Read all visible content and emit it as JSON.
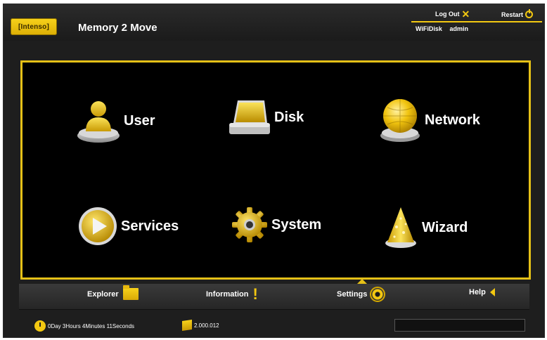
{
  "header": {
    "logo_text": "[Intenso]",
    "app_title": "Memory 2 Move",
    "logout_label": "Log Out",
    "restart_label": "Restart",
    "device_name": "WiFiDisk",
    "username": "admin"
  },
  "main": {
    "tiles": [
      {
        "label": "User",
        "icon": "user-icon"
      },
      {
        "label": "Disk",
        "icon": "disk-icon"
      },
      {
        "label": "Network",
        "icon": "network-globe-icon"
      },
      {
        "label": "Services",
        "icon": "play-icon"
      },
      {
        "label": "System",
        "icon": "gear-icon"
      },
      {
        "label": "Wizard",
        "icon": "wizard-hat-icon"
      }
    ]
  },
  "nav": {
    "explorer": "Explorer",
    "information": "Information",
    "settings": "Settings",
    "help": "Help",
    "active": "Settings"
  },
  "status": {
    "uptime": "0Day 3Hours 4Minutes 11Seconds",
    "version": "2.000.012"
  },
  "colors": {
    "accent": "#e5c017",
    "background": "#1e1e1e",
    "panel": "#000000"
  }
}
